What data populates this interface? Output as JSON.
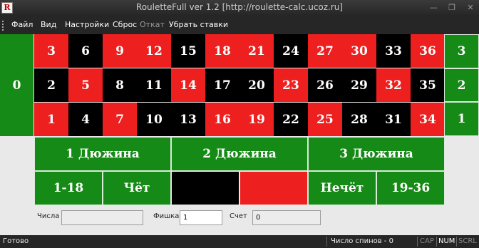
{
  "window": {
    "icon_letter": "R",
    "title": "RouletteFull ver 1.2  [http://roulette-calc.ucoz.ru]",
    "minimize": "—",
    "maximize": "❐",
    "close": "✕"
  },
  "menu": [
    "Файл",
    "Вид",
    "Настройки",
    "Сброс",
    "Откат",
    "Убрать ставки"
  ],
  "menu_disabled": [
    "Откат"
  ],
  "table": {
    "zero": "0",
    "rows": [
      [
        {
          "n": "3",
          "c": "red"
        },
        {
          "n": "6",
          "c": "black"
        },
        {
          "n": "9",
          "c": "red"
        },
        {
          "n": "12",
          "c": "red"
        },
        {
          "n": "15",
          "c": "black"
        },
        {
          "n": "18",
          "c": "red"
        },
        {
          "n": "21",
          "c": "red"
        },
        {
          "n": "24",
          "c": "black"
        },
        {
          "n": "27",
          "c": "red"
        },
        {
          "n": "30",
          "c": "red"
        },
        {
          "n": "33",
          "c": "black"
        },
        {
          "n": "36",
          "c": "red"
        }
      ],
      [
        {
          "n": "2",
          "c": "black"
        },
        {
          "n": "5",
          "c": "red"
        },
        {
          "n": "8",
          "c": "black"
        },
        {
          "n": "11",
          "c": "black"
        },
        {
          "n": "14",
          "c": "red"
        },
        {
          "n": "17",
          "c": "black"
        },
        {
          "n": "20",
          "c": "black"
        },
        {
          "n": "23",
          "c": "red"
        },
        {
          "n": "26",
          "c": "black"
        },
        {
          "n": "29",
          "c": "black"
        },
        {
          "n": "32",
          "c": "red"
        },
        {
          "n": "35",
          "c": "black"
        }
      ],
      [
        {
          "n": "1",
          "c": "red"
        },
        {
          "n": "4",
          "c": "black"
        },
        {
          "n": "7",
          "c": "red"
        },
        {
          "n": "10",
          "c": "black"
        },
        {
          "n": "13",
          "c": "black"
        },
        {
          "n": "16",
          "c": "red"
        },
        {
          "n": "19",
          "c": "red"
        },
        {
          "n": "22",
          "c": "black"
        },
        {
          "n": "25",
          "c": "red"
        },
        {
          "n": "28",
          "c": "black"
        },
        {
          "n": "31",
          "c": "black"
        },
        {
          "n": "34",
          "c": "red"
        }
      ]
    ],
    "columns": [
      "3",
      "2",
      "1"
    ],
    "dozens": [
      "1 Дюжина",
      "2 Дюжина",
      "3 Дюжина"
    ],
    "outside": {
      "low": "1-18",
      "even": "Чёт",
      "odd": "Нечёт",
      "high": "19-36"
    }
  },
  "fields": {
    "numbers_label": "Числа",
    "numbers_value": "",
    "chip_label": "Фишка",
    "chip_value": "1",
    "score_label": "Счет",
    "score_value": "0"
  },
  "statusbar": {
    "ready": "Готово",
    "spins": "Число спинов - 0",
    "cap": "CAP",
    "num": "NUM",
    "scrl": "SCRL"
  },
  "colors": {
    "red": "#ee1f1f",
    "black": "#000000",
    "green": "#168a16"
  }
}
